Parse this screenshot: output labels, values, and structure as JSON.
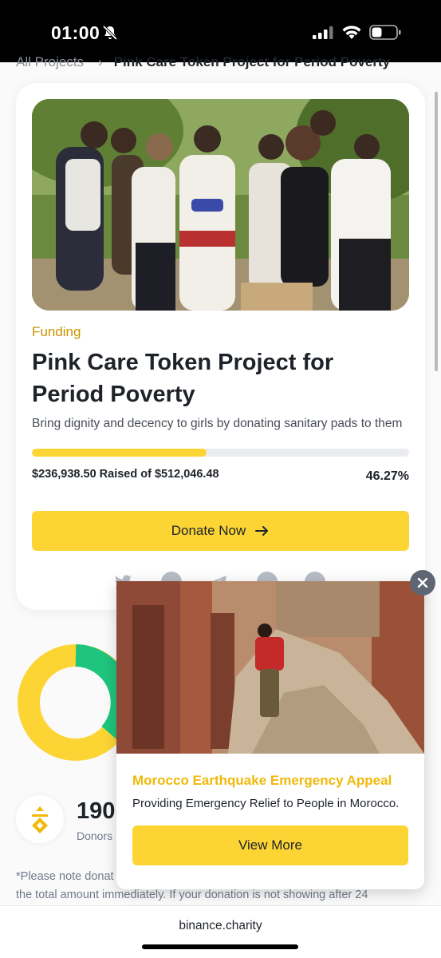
{
  "status_bar": {
    "time": "01:00"
  },
  "breadcrumb": {
    "parent": "All Projects",
    "separator": "›",
    "current": "Pink Care Token Project for Period Poverty"
  },
  "project": {
    "status_tag": "Funding",
    "title": "Pink Care Token Project for Period Poverty",
    "description": "Bring dignity and decency to girls by donating sanitary pads to them",
    "raised_text": "$236,938.50 Raised of $512,046.48",
    "percent_text": "46.27%",
    "progress_fraction": 0.4627,
    "donate_label": "Donate Now",
    "share_icons": [
      "twitter-icon",
      "facebook-icon",
      "telegram-icon",
      "reddit-icon",
      "vk-icon"
    ]
  },
  "donation_chart": {
    "type": "pie",
    "colors": [
      "#fcd535",
      "#1fc47d"
    ]
  },
  "donors": {
    "count": "190",
    "label": "Donors"
  },
  "note": {
    "line1": "*Please note donat",
    "line2": "the total amount immediately. If your donation is not showing after 24"
  },
  "popup": {
    "title": "Morocco Earthquake Emergency Appeal",
    "description": "Providing Emergency Relief to People in Morocco.",
    "button_label": "View More"
  },
  "url_bar": {
    "url": "binance.charity"
  },
  "colors": {
    "accent": "#fcd535",
    "tag": "#c99400",
    "popup_title": "#f0b90b",
    "donut_green": "#1fc47d"
  }
}
